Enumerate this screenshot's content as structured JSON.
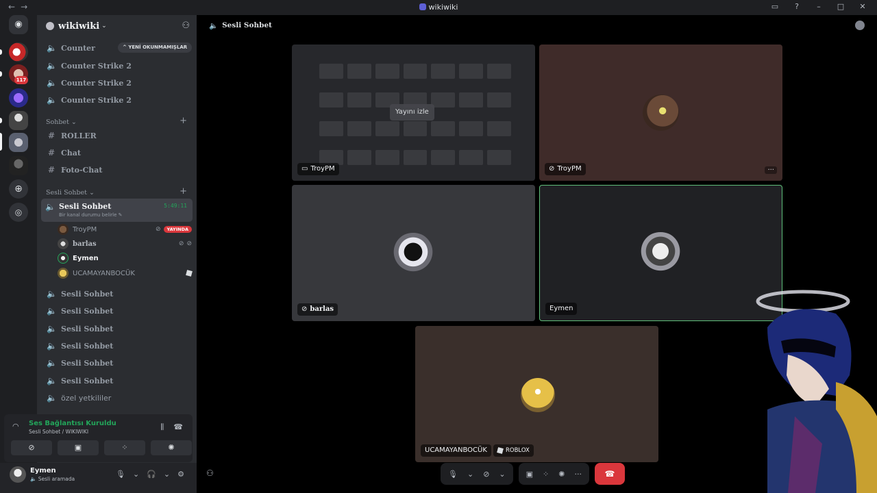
{
  "window": {
    "title": "wikiwiki",
    "back": "←",
    "forward": "→"
  },
  "server": {
    "name": "wikiwiki",
    "unread_pill": "YENİ OKUNMAMIŞLAR"
  },
  "channels_top": [
    {
      "name": "Counter"
    },
    {
      "name": "Counter Strike 2"
    },
    {
      "name": "Counter Strike 2"
    },
    {
      "name": "Counter Strike 2"
    }
  ],
  "text_category": {
    "label": "Sohbet"
  },
  "text_channels": [
    {
      "name": "ROLLER"
    },
    {
      "name": "Chat"
    },
    {
      "name": "Foto-Chat"
    }
  ],
  "voice_category": {
    "label": "Sesli Sohbet"
  },
  "active_voice": {
    "name": "Sesli Sohbet",
    "timer": "5:49:11",
    "status": "Bir kanal durumu belirle"
  },
  "members": [
    {
      "name": "TroyPM",
      "live": "YAYINDA"
    },
    {
      "name": "barlas"
    },
    {
      "name": "Eymen"
    },
    {
      "name": "UCAMAYANBOCÜK"
    }
  ],
  "voice_channels": [
    {
      "name": "Sesli Sohbet"
    },
    {
      "name": "Sesli Sohbet"
    },
    {
      "name": "Sesli Sohbet"
    },
    {
      "name": "Sesli Sohbet"
    },
    {
      "name": "Sesli Sohbet"
    },
    {
      "name": "Sesli Sohbet"
    },
    {
      "name": "özel yetkililer"
    }
  ],
  "rail": {
    "badge": "117"
  },
  "voice_panel": {
    "status": "Ses Bağlantısı Kuruldu",
    "location": "Sesli Sohbet / WIKIWIKI"
  },
  "user": {
    "name": "Eymen",
    "status": "Sesli aramada"
  },
  "main": {
    "channel_title": "Sesli Sohbet"
  },
  "tiles": {
    "stream": {
      "label": "TroyPM",
      "watch": "Yayını izle"
    },
    "troypm": {
      "label": "TroyPM",
      "more": "···"
    },
    "barlas": {
      "label": "barlas"
    },
    "eymen": {
      "label": "Eymen"
    },
    "ucamayan": {
      "label": "UCAMAYANBOCÜK",
      "activity": "ROBLOX"
    }
  },
  "colors": {
    "accent_green": "#23a55a",
    "live_red": "#da373c",
    "speaking_border": "#5fbf7a"
  }
}
